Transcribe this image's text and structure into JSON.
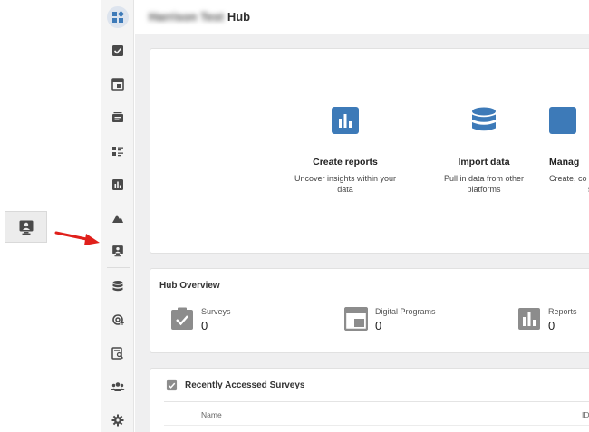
{
  "header": {
    "org_name": "Harrison Test",
    "title": "Hub"
  },
  "sidebar": {
    "items": [
      {
        "name": "hub-logo-icon"
      },
      {
        "name": "checklist-icon"
      },
      {
        "name": "window-icon"
      },
      {
        "name": "contacts-icon"
      },
      {
        "name": "list-icon"
      },
      {
        "name": "bar-chart-icon"
      },
      {
        "name": "mountain-icon"
      },
      {
        "name": "kiosk-icon"
      },
      {
        "name": "database-icon"
      },
      {
        "name": "at-sync-icon"
      },
      {
        "name": "search-report-icon"
      },
      {
        "name": "users-icon"
      },
      {
        "name": "gear-icon"
      }
    ]
  },
  "actions": [
    {
      "title": "Create reports",
      "desc": "Uncover insights within your data",
      "icon": "bar-chart-icon"
    },
    {
      "title": "Import data",
      "desc": "Pull in data from other platforms",
      "icon": "database-icon"
    },
    {
      "title": "Manag",
      "desc": "Create, co",
      "desc2": "s",
      "icon": "manage-icon"
    }
  ],
  "overview": {
    "title": "Hub Overview",
    "items": [
      {
        "label": "Surveys",
        "count": "0",
        "icon": "survey-icon"
      },
      {
        "label": "Digital Programs",
        "count": "0",
        "icon": "window-icon"
      },
      {
        "label": "Reports",
        "count": "0",
        "icon": "bar-chart-icon"
      }
    ]
  },
  "recent": {
    "title": "Recently Accessed Surveys",
    "columns": {
      "name": "Name",
      "id": "ID"
    }
  },
  "colors": {
    "accent": "#3d7ab8",
    "icon_gray": "#4a4a4a",
    "arrow": "#e0201b"
  }
}
